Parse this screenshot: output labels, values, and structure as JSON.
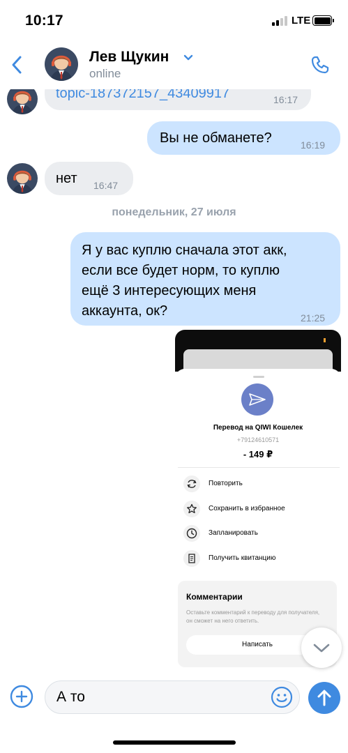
{
  "status_bar": {
    "time": "10:17",
    "network": "LTE"
  },
  "header": {
    "name": "Лев Щукин",
    "status": "online"
  },
  "messages": [
    {
      "type": "incoming",
      "text": "topic-187372157_43409917",
      "time": "16:17"
    },
    {
      "type": "outgoing",
      "text": "Вы не обманете?",
      "time": "16:19"
    },
    {
      "type": "incoming",
      "text": "нет",
      "time": "16:47"
    },
    {
      "type": "date",
      "text": "понедельник, 27 июля"
    },
    {
      "type": "outgoing",
      "lines": [
        "Я у вас куплю сначала этот акк,",
        "если все будет норм, то куплю",
        "ещё 3 интересующих меня",
        "аккаунта, ок?"
      ],
      "time": "21:25"
    }
  ],
  "photo": {
    "title": "Перевод на QIWI Кошелек",
    "phone": "+79124610571",
    "amount": "- 149 ₽",
    "actions": [
      "Повторить",
      "Сохранить в избранное",
      "Запланировать",
      "Получить квитанцию"
    ],
    "comments_title": "Комментарии",
    "comments_desc": "Оставьте комментарий к переводу для получателя, он сможет на него ответить.",
    "write_button": "Написать"
  },
  "composer": {
    "value": "А то"
  },
  "colors": {
    "accent": "#3f8ae0",
    "incoming_bubble": "#ebedf0",
    "outgoing_bubble": "#cce4ff",
    "secondary_text": "#818c99"
  }
}
